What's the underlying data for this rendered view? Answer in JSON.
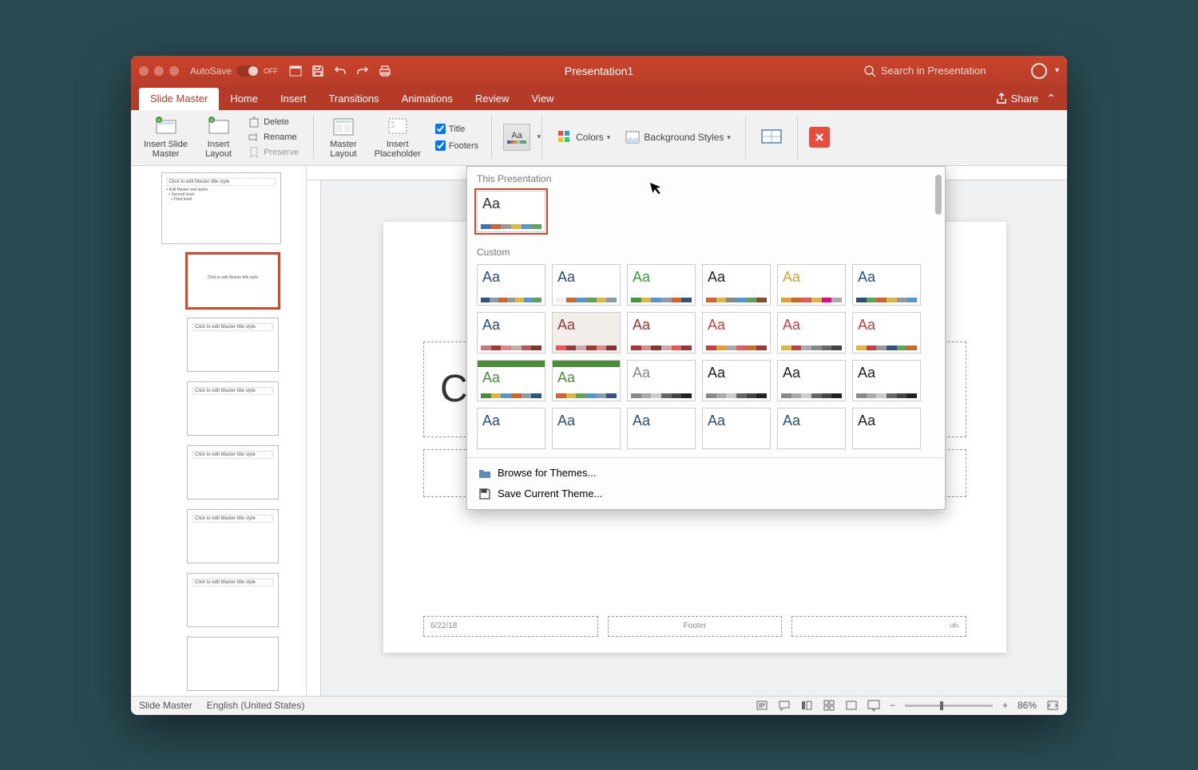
{
  "titlebar": {
    "autosave_label": "AutoSave",
    "autosave_state": "OFF",
    "doc_title": "Presentation1",
    "search_placeholder": "Search in Presentation"
  },
  "tabs": {
    "items": [
      "Slide Master",
      "Home",
      "Insert",
      "Transitions",
      "Animations",
      "Review",
      "View"
    ],
    "active": "Slide Master",
    "share": "Share"
  },
  "ribbon": {
    "insert_slide_master": "Insert Slide\nMaster",
    "insert_layout": "Insert\nLayout",
    "delete": "Delete",
    "rename": "Rename",
    "preserve": "Preserve",
    "master_layout": "Master\nLayout",
    "insert_placeholder": "Insert\nPlaceholder",
    "title_chk": "Title",
    "footers_chk": "Footers",
    "colors": "Colors",
    "bg_styles": "Background Styles"
  },
  "themes_popup": {
    "section1": "This Presentation",
    "section2": "Custom",
    "browse": "Browse for Themes...",
    "save": "Save Current Theme...",
    "this_theme": {
      "aa": "Aa",
      "aa_color": "#333",
      "colors": [
        "#3b6fb6",
        "#d4652a",
        "#999",
        "#e0b73e",
        "#5397d5",
        "#5fa456"
      ]
    },
    "custom_themes": [
      {
        "aa_color": "#2a4d7f",
        "colors": [
          "#30537f",
          "#8a9bab",
          "#d4652a",
          "#999",
          "#e0b73e",
          "#5397d5",
          "#5fa456"
        ]
      },
      {
        "aa_color": "#2a4d7f",
        "colors": [
          "#eee",
          "#d4652a",
          "#5397d5",
          "#5fa456",
          "#e0b73e",
          "#8a9bab"
        ]
      },
      {
        "aa_color": "#3d9b3d",
        "colors": [
          "#3d9b3d",
          "#e0b73e",
          "#5397d5",
          "#8a9bab",
          "#d4652a",
          "#30537f"
        ]
      },
      {
        "aa_color": "#222",
        "colors": [
          "#d4652a",
          "#e0b73e",
          "#888",
          "#5397d5",
          "#5fa456",
          "#8a4a2a"
        ]
      },
      {
        "aa_color": "#e0a030",
        "colors": [
          "#e0a030",
          "#d4652a",
          "#e55",
          "#e0b73e",
          "#e08",
          "#aaa"
        ]
      },
      {
        "aa_color": "#2a4d7f",
        "colors": [
          "#2a4d7f",
          "#5fa456",
          "#d4652a",
          "#e0b73e",
          "#999",
          "#5397d5"
        ]
      },
      {
        "aa_color": "#2a4d7f",
        "colors": [
          "#c77",
          "#a33",
          "#d88",
          "#caa",
          "#b55",
          "#833"
        ]
      },
      {
        "aa_color": "#963838",
        "colors": [
          "#e55",
          "#963838",
          "#caa",
          "#a33",
          "#d88",
          "#833"
        ],
        "bg": "#f2eee9"
      },
      {
        "aa_color": "#a03030",
        "colors": [
          "#a33",
          "#d88",
          "#833",
          "#caa",
          "#e55",
          "#963838"
        ]
      },
      {
        "aa_color": "#c84040",
        "colors": [
          "#c84040",
          "#e0a030",
          "#aaa",
          "#e55",
          "#d4652a",
          "#963838"
        ]
      },
      {
        "aa_color": "#c84040",
        "colors": [
          "#e0b73e",
          "#c84040",
          "#aaa",
          "#888",
          "#666",
          "#444"
        ]
      },
      {
        "aa_color": "#c84040",
        "colors": [
          "#e0b73e",
          "#c84040",
          "#999",
          "#30537f",
          "#5fa456",
          "#d4652a"
        ]
      },
      {
        "aa_color": "#4c8c3a",
        "colors": [
          "#4c8c3a",
          "#e0b73e",
          "#5397d5",
          "#d4652a",
          "#8a9bab",
          "#30537f"
        ],
        "header": "#4c8c3a"
      },
      {
        "aa_color": "#4c8c3a",
        "colors": [
          "#d4652a",
          "#e0b73e",
          "#5fa456",
          "#5397d5",
          "#8a9bab",
          "#30537f"
        ],
        "header": "#4c8c3a"
      },
      {
        "aa_color": "#888",
        "colors": [
          "#888",
          "#aaa",
          "#ccc",
          "#666",
          "#444",
          "#222"
        ]
      },
      {
        "aa_color": "#222",
        "colors": [
          "#888",
          "#aaa",
          "#ccc",
          "#666",
          "#444",
          "#222"
        ]
      },
      {
        "aa_color": "#222",
        "colors": [
          "#888",
          "#aaa",
          "#ccc",
          "#666",
          "#444",
          "#222"
        ]
      },
      {
        "aa_color": "#222",
        "colors": [
          "#888",
          "#aaa",
          "#ccc",
          "#666",
          "#444",
          "#222"
        ]
      },
      {
        "aa_color": "#2a4d7f",
        "colors": []
      },
      {
        "aa_color": "#2a4d7f",
        "colors": []
      },
      {
        "aa_color": "#2a4d7f",
        "colors": []
      },
      {
        "aa_color": "#2a4d7f",
        "colors": []
      },
      {
        "aa_color": "#2a4d7f",
        "colors": []
      },
      {
        "aa_color": "#222",
        "colors": []
      }
    ]
  },
  "thumbs": {
    "master": "Click to edit Master title style",
    "layouts": [
      "Click to edit Master title style",
      "Click to edit Master title style",
      "Click to edit Master title style",
      "Click to edit Master title style",
      "Click to edit Master title style",
      "Click to edit Master title style"
    ]
  },
  "slide": {
    "title_ph": "C",
    "date": "6/22/18",
    "footer": "Footer",
    "num": "‹#›"
  },
  "status": {
    "view": "Slide Master",
    "lang": "English (United States)",
    "zoom": "86%"
  }
}
